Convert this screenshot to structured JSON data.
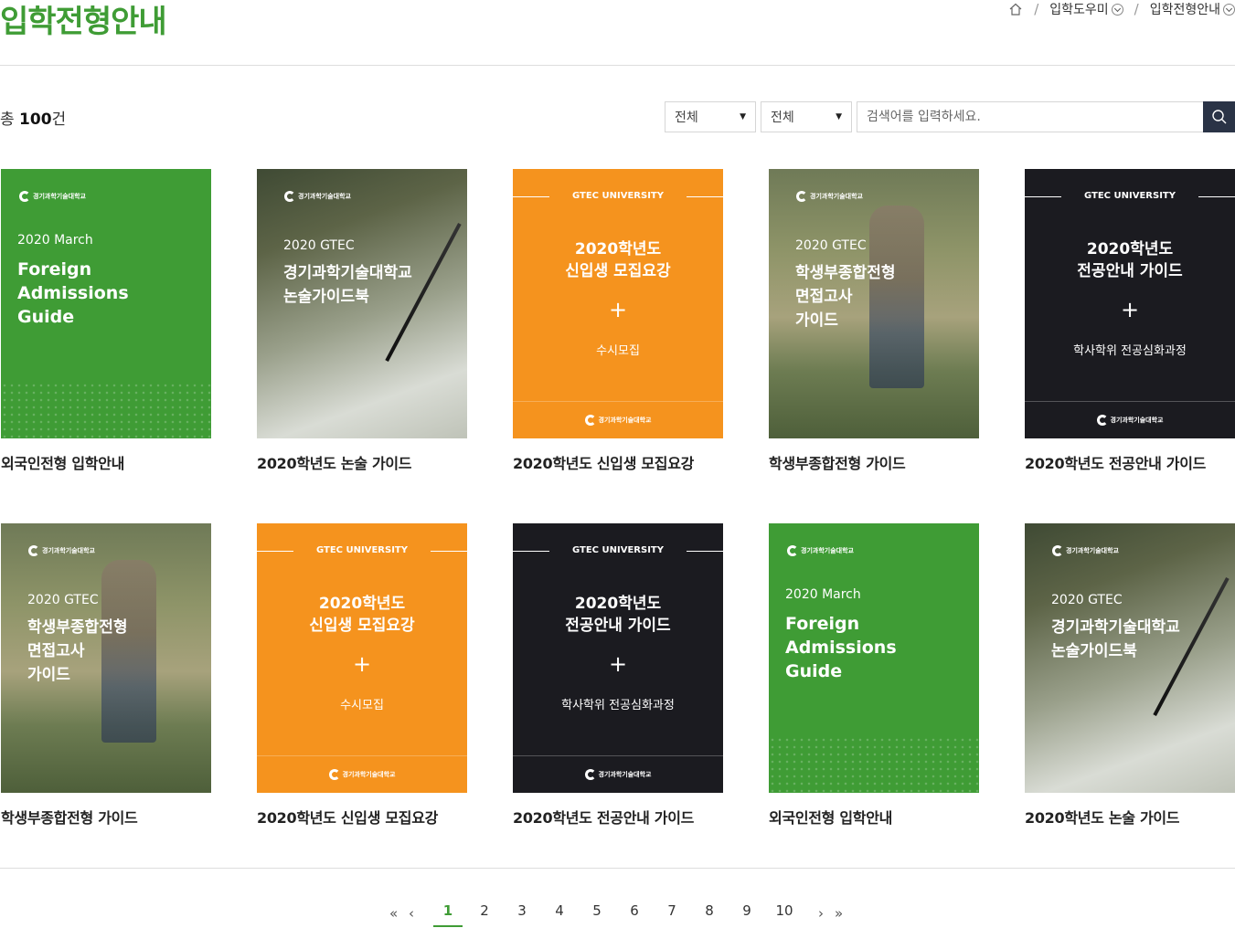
{
  "page": {
    "title": "입학전형안내"
  },
  "breadcrumb": {
    "home_icon": "home-icon",
    "level1": "입학도우미",
    "level2": "입학전형안내",
    "separator": "/"
  },
  "list": {
    "total_prefix": "총",
    "total_count": "100",
    "total_suffix": "건"
  },
  "filters": {
    "select1_value": "전체",
    "select2_value": "전체",
    "search_placeholder": "검색어를 입력하세요.",
    "search_icon": "search-icon"
  },
  "cards": [
    {
      "title": "외국인전형 입학안내",
      "style": "green",
      "logo": "경기과학기술대학교",
      "sub": "2020 March",
      "big": "Foreign\nAdmissions\nGuide"
    },
    {
      "title": "2020학년도 논술 가이드",
      "style": "photo2",
      "logo": "경기과학기술대학교",
      "sub": "2020 GTEC",
      "big": "경기과학기술대학교\n논술가이드북"
    },
    {
      "title": "2020학년도 신입생 모집요강",
      "style": "orange",
      "band": "GTEC UNIVERSITY",
      "big": "2020학년도\n신입생 모집요강",
      "plus": "+",
      "small": "수시모집",
      "logo": "경기과학기술대학교"
    },
    {
      "title": "학생부종합전형 가이드",
      "style": "photo1",
      "logo": "경기과학기술대학교",
      "sub": "2020 GTEC",
      "big": "학생부종합전형\n면접고사\n가이드"
    },
    {
      "title": "2020학년도 전공안내 가이드",
      "style": "dark",
      "band": "GTEC UNIVERSITY",
      "big": "2020학년도\n전공안내 가이드",
      "plus": "+",
      "small": "학사학위 전공심화과정",
      "logo": "경기과학기술대학교"
    },
    {
      "title": "학생부종합전형 가이드",
      "style": "photo1",
      "logo": "경기과학기술대학교",
      "sub": "2020 GTEC",
      "big": "학생부종합전형\n면접고사\n가이드"
    },
    {
      "title": "2020학년도 신입생 모집요강",
      "style": "orange",
      "band": "GTEC UNIVERSITY",
      "big": "2020학년도\n신입생 모집요강",
      "plus": "+",
      "small": "수시모집",
      "logo": "경기과학기술대학교"
    },
    {
      "title": "2020학년도 전공안내 가이드",
      "style": "dark",
      "band": "GTEC UNIVERSITY",
      "big": "2020학년도\n전공안내 가이드",
      "plus": "+",
      "small": "학사학위 전공심화과정",
      "logo": "경기과학기술대학교"
    },
    {
      "title": "외국인전형 입학안내",
      "style": "green",
      "logo": "경기과학기술대학교",
      "sub": "2020 March",
      "big": "Foreign\nAdmissions\nGuide"
    },
    {
      "title": "2020학년도 논술 가이드",
      "style": "photo2",
      "logo": "경기과학기술대학교",
      "sub": "2020 GTEC",
      "big": "경기과학기술대학교\n논술가이드북"
    }
  ],
  "pagination": {
    "first": "«",
    "prev": "‹",
    "next": "›",
    "last": "»",
    "current": "1",
    "pages": [
      "1",
      "2",
      "3",
      "4",
      "5",
      "6",
      "7",
      "8",
      "9",
      "10"
    ]
  },
  "colors": {
    "brand_green": "#3f9c35",
    "orange": "#f5931e",
    "dark": "#1b1b20",
    "search_button": "#2a3346"
  }
}
